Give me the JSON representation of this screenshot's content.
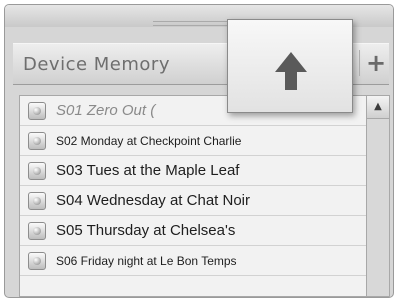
{
  "panel": {
    "title": "Device Memory",
    "add_label": "+"
  },
  "list": {
    "items": [
      {
        "label": "S01 Zero Out (",
        "color": "#8a8a8a",
        "style": "italic"
      },
      {
        "label": "S02 Monday at Checkpoint Charlie"
      },
      {
        "label": "S03 Tues at the Maple Leaf"
      },
      {
        "label": "S04 Wednesday at Chat Noir"
      },
      {
        "label": "S05 Thursday at Chelsea's"
      },
      {
        "label": "S06 Friday night at Le Bon Temps"
      }
    ]
  },
  "scrollbar": {
    "up_label": "▲"
  },
  "popup": {
    "icon": "upload-arrow-icon"
  },
  "colors": {
    "panel_bg": "#d6d6d6",
    "list_bg": "#f2f2f2",
    "text": "#1e1e1e",
    "dim_text": "#8a8a8a"
  }
}
